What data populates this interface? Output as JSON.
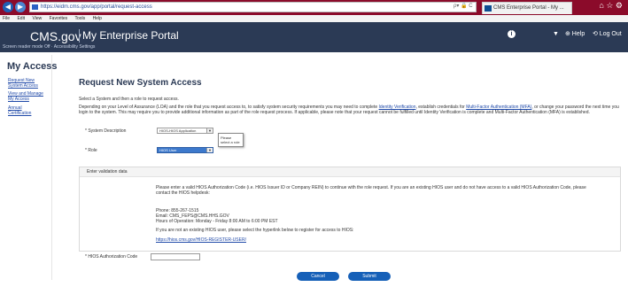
{
  "browser": {
    "address": "https://eidm.cms.gov/app/portal/request-access",
    "address_tools": "ρ▾ 🔒 C",
    "tab_title": "CMS Enterprise Portal - My ...",
    "window_controls": "⌂ ☆ ⚙",
    "menu": [
      "File",
      "Edit",
      "View",
      "Favorites",
      "Tools",
      "Help"
    ]
  },
  "header": {
    "logo": "CMS.gov",
    "portal_name": "My Enterprise Portal",
    "skip_links": "Screen reader mode Off · Accessibility Settings",
    "help": "⊕ Help",
    "logout": "⟲ Log Out",
    "info_icon": "i"
  },
  "sidebar": {
    "title": "My Access",
    "links": [
      {
        "label": "Request New System Access"
      },
      {
        "label": "View and Manage My Access"
      },
      {
        "label": "Annual Certification"
      }
    ]
  },
  "main": {
    "title": "Request New System Access",
    "intro": "Select a System and then a role to request access.",
    "para_part1": "Depending on your Level of Assurance (LOA) and the role that you request access to, to satisfy system security requirements you may need to complete ",
    "link_identity": "Identity Verification",
    "para_part2": ", establish credentials for ",
    "link_mfa": "Multi-Factor Authentication (MFA)",
    "para_part3": ", or change your password the next time you login to the system. This may require you to provide additional information as part of the role request process. If applicable, please note that your request cannot be fulfilled until Identity Verification is complete and Multi-Factor Authentication (MFA) is established.",
    "system_label": "* System Description",
    "system_value": "HIOS-HIOS Application",
    "tooltip": "Please select a role",
    "role_label": "* Role",
    "role_value": "HIOS User"
  },
  "validation": {
    "heading": "Enter validation data",
    "text1": "Please enter a valid HIOS Authorization Code (i.e. HIOS Issuer ID or Company REIN) to continue with the role request. If you are an existing HIOS user and do not have access to a valid HIOS Authorization Code, please contact the HIOS helpdesk:",
    "phone": "Phone: 855-267-1515",
    "email": "Email: CMS_FEPS@CMS.HHS.GOV",
    "hours": "Hours of Operation: Monday - Friday 8:00 AM to 6:00 PM EST",
    "text2": "If you are not an existing HIOS user, please select the hyperlink below to register for access to HIOS:",
    "link": "https://hios.cms.gov/HIOS-REGISTER-USER/",
    "code_label": "* HIOS Authorization Code"
  },
  "buttons": {
    "cancel": "Cancel",
    "submit": "Submit"
  }
}
